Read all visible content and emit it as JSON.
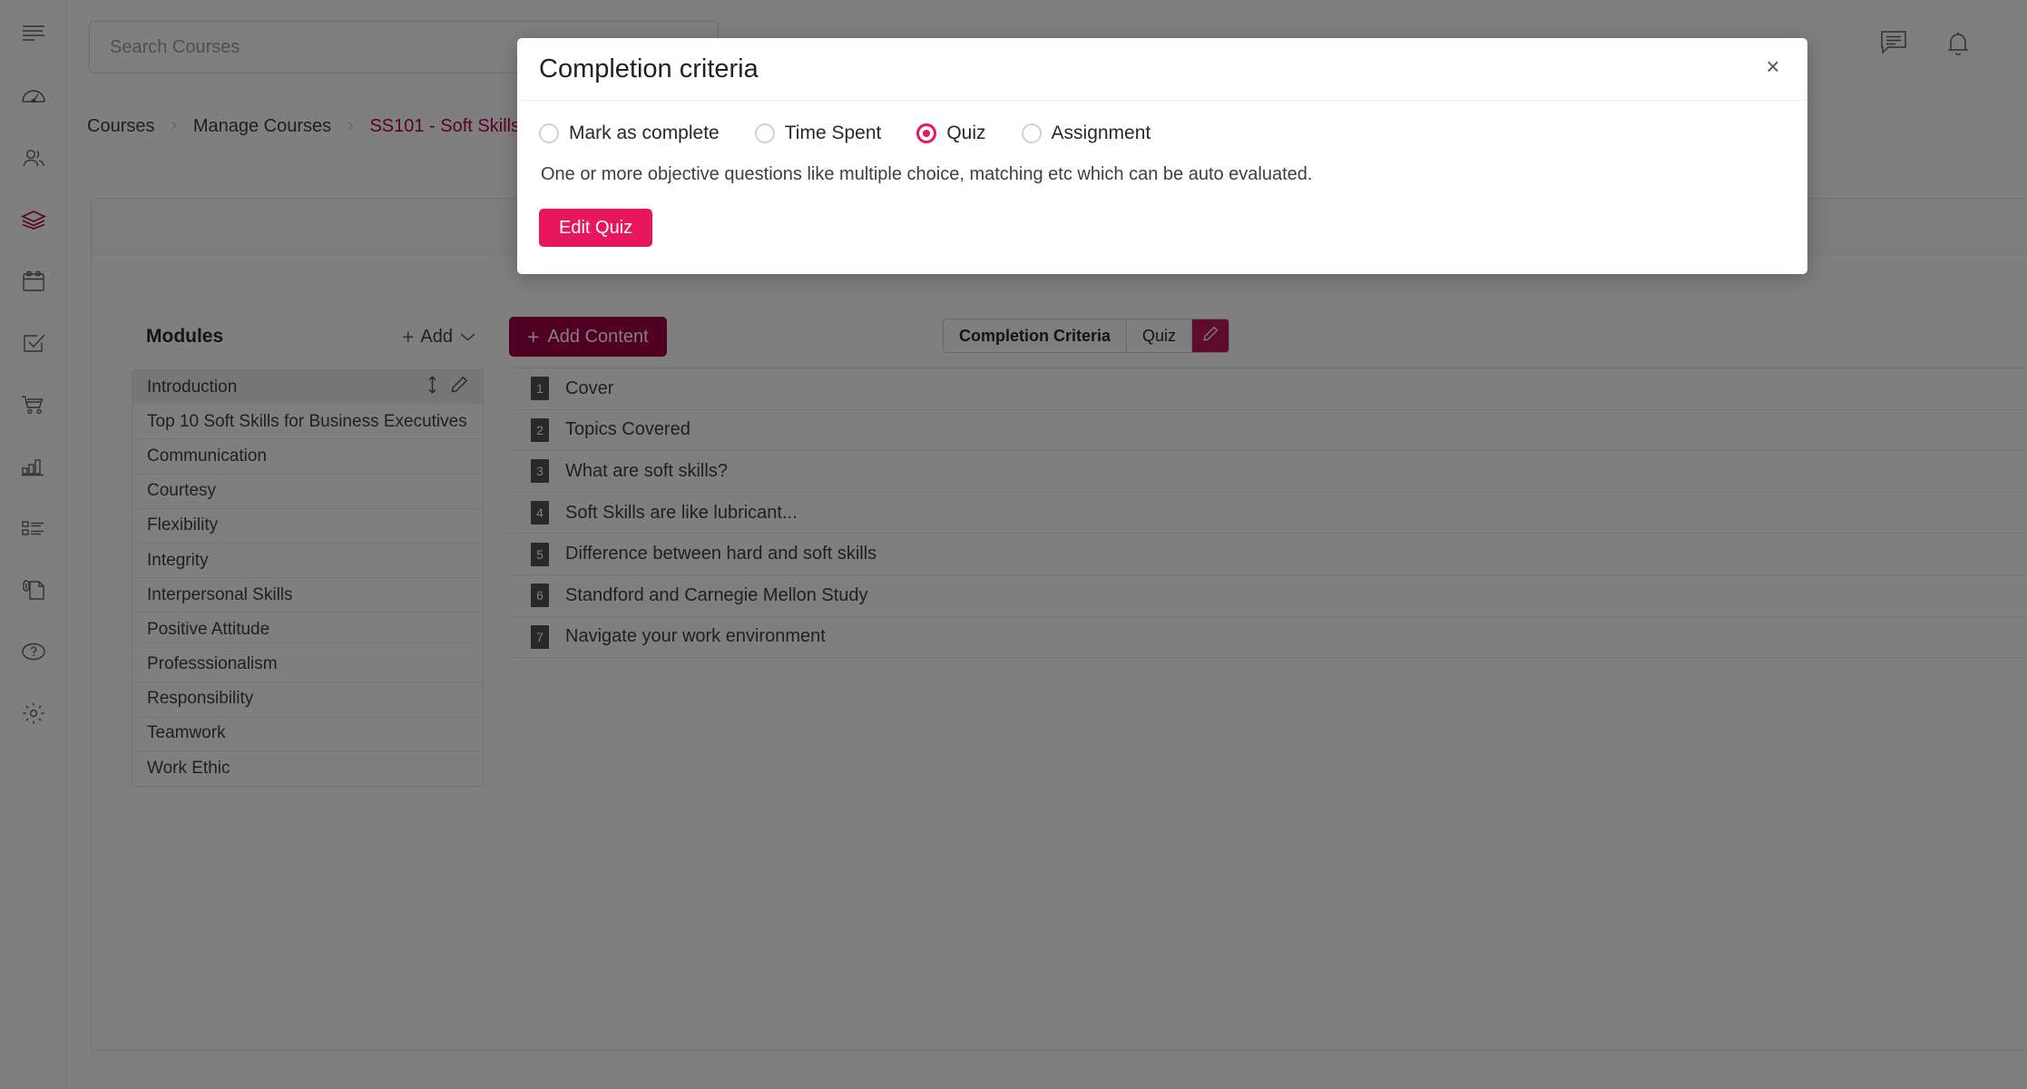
{
  "rail": {
    "items": [
      {
        "icon": "hamburger-menu-icon",
        "name": "menu-toggle",
        "active": false
      },
      {
        "icon": "dashboard-gauge-icon",
        "name": "sidebar-item-dashboard",
        "active": false
      },
      {
        "icon": "users-icon",
        "name": "sidebar-item-users",
        "active": false
      },
      {
        "icon": "layers-icon",
        "name": "sidebar-item-courses",
        "active": true
      },
      {
        "icon": "calendar-icon",
        "name": "sidebar-item-calendar",
        "active": false
      },
      {
        "icon": "checkbox-task-icon",
        "name": "sidebar-item-tasks",
        "active": false
      },
      {
        "icon": "shopping-cart-icon",
        "name": "sidebar-item-store",
        "active": false
      },
      {
        "icon": "bar-chart-icon",
        "name": "sidebar-item-reports",
        "active": false
      },
      {
        "icon": "list-icon",
        "name": "sidebar-item-catalog",
        "active": false
      },
      {
        "icon": "document-attachment-icon",
        "name": "sidebar-item-files",
        "active": false
      },
      {
        "icon": "help-circle-icon",
        "name": "sidebar-item-help",
        "active": false
      },
      {
        "icon": "gear-icon",
        "name": "sidebar-item-settings",
        "active": false
      }
    ]
  },
  "topbar": {
    "search": {
      "value": "",
      "placeholder": "Search Courses"
    },
    "chat_icon": "chat-bubble-icon",
    "bell_icon": "notification-bell-icon"
  },
  "breadcrumb": {
    "separator": "›",
    "items": [
      {
        "label": "Courses",
        "current": false
      },
      {
        "label": "Manage Courses",
        "current": false
      },
      {
        "label": "SS101 - Soft Skills",
        "current": true
      }
    ]
  },
  "modules": {
    "title": "Modules",
    "add_label": "Add",
    "add_plus": "+",
    "chevron": "chevron-down-icon",
    "items": [
      {
        "label": "Introduction",
        "selected": true
      },
      {
        "label": "Top 10 Soft Skills for Business Executives",
        "selected": false
      },
      {
        "label": "Communication",
        "selected": false
      },
      {
        "label": "Courtesy",
        "selected": false
      },
      {
        "label": "Flexibility",
        "selected": false
      },
      {
        "label": "Integrity",
        "selected": false
      },
      {
        "label": "Interpersonal Skills",
        "selected": false
      },
      {
        "label": "Positive Attitude",
        "selected": false
      },
      {
        "label": "Professsionalism",
        "selected": false
      },
      {
        "label": "Responsibility",
        "selected": false
      },
      {
        "label": "Teamwork",
        "selected": false
      },
      {
        "label": "Work Ethic",
        "selected": false
      }
    ]
  },
  "content": {
    "add_content_label": "Add Content",
    "add_content_plus": "+",
    "criteria_tabs": [
      {
        "label": "Completion Criteria",
        "bold": true
      },
      {
        "label": "Quiz",
        "bold": false
      }
    ],
    "edit_icon": "pencil-icon",
    "rows": [
      {
        "num": "1",
        "label": "Cover"
      },
      {
        "num": "2",
        "label": "Topics Covered"
      },
      {
        "num": "3",
        "label": "What are soft skills?"
      },
      {
        "num": "4",
        "label": "Soft Skills are like lubricant..."
      },
      {
        "num": "5",
        "label": "Difference between hard and soft skills"
      },
      {
        "num": "6",
        "label": "Standford and Carnegie Mellon Study"
      },
      {
        "num": "7",
        "label": "Navigate your work environment"
      }
    ]
  },
  "modal": {
    "title": "Completion criteria",
    "close_label": "×",
    "options": [
      {
        "label": "Mark as complete",
        "checked": false
      },
      {
        "label": "Time Spent",
        "checked": false
      },
      {
        "label": "Quiz",
        "checked": true
      },
      {
        "label": "Assignment",
        "checked": false
      }
    ],
    "description": "One or more objective questions like multiple choice, matching etc which can be auto evaluated.",
    "primary_button": "Edit Quiz"
  },
  "colors": {
    "accent_pink": "#e8165c",
    "brand_crimson": "#a50044",
    "edit_badge": "#c2185b",
    "text": "#3c4043",
    "overlay": "rgba(0,0,0,0.5)"
  }
}
